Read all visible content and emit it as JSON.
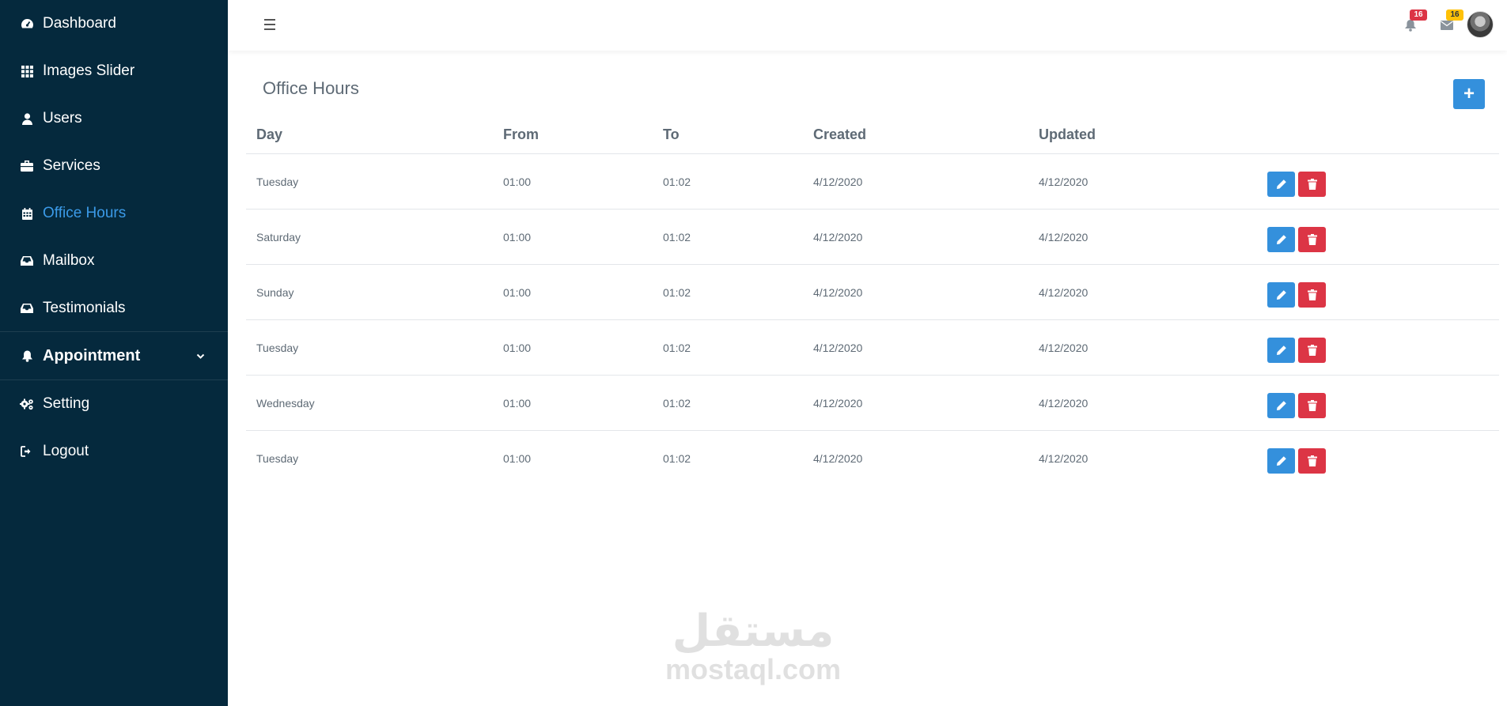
{
  "sidebar": {
    "items": [
      {
        "label": "Dashboard",
        "icon": "dashboard-icon"
      },
      {
        "label": "Images Slider",
        "icon": "grid-icon"
      },
      {
        "label": "Users",
        "icon": "user-icon"
      },
      {
        "label": "Services",
        "icon": "briefcase-icon"
      },
      {
        "label": "Office Hours",
        "icon": "calendar-icon",
        "active": true
      },
      {
        "label": "Mailbox",
        "icon": "inbox-icon"
      },
      {
        "label": "Testimonials",
        "icon": "inbox-icon"
      },
      {
        "label": "Appointment",
        "icon": "bell-icon",
        "expandable": true
      },
      {
        "label": "Setting",
        "icon": "gears-icon"
      },
      {
        "label": "Logout",
        "icon": "sign-out-icon"
      }
    ]
  },
  "topbar": {
    "notifications_count": "16",
    "messages_count": "16"
  },
  "page": {
    "title": "Office Hours",
    "add_button": "+"
  },
  "table": {
    "headers": [
      "Day",
      "From",
      "To",
      "Created",
      "Updated"
    ],
    "rows": [
      [
        "Tuesday",
        "01:00",
        "01:02",
        "4/12/2020",
        "4/12/2020"
      ],
      [
        "Saturday",
        "01:00",
        "01:02",
        "4/12/2020",
        "4/12/2020"
      ],
      [
        "Sunday",
        "01:00",
        "01:02",
        "4/12/2020",
        "4/12/2020"
      ],
      [
        "Tuesday",
        "01:00",
        "01:02",
        "4/12/2020",
        "4/12/2020"
      ],
      [
        "Wednesday",
        "01:00",
        "01:02",
        "4/12/2020",
        "4/12/2020"
      ],
      [
        "Tuesday",
        "01:00",
        "01:02",
        "4/12/2020",
        "4/12/2020"
      ]
    ]
  },
  "watermark": {
    "arabic": "مستقل",
    "latin": "mostaql.com"
  },
  "colors": {
    "sidebar_bg": "#05293d",
    "active": "#3b9ae8",
    "edit": "#3490dc",
    "delete": "#dc3545",
    "badge_red": "#dc3545",
    "badge_yellow": "#ffc107"
  }
}
